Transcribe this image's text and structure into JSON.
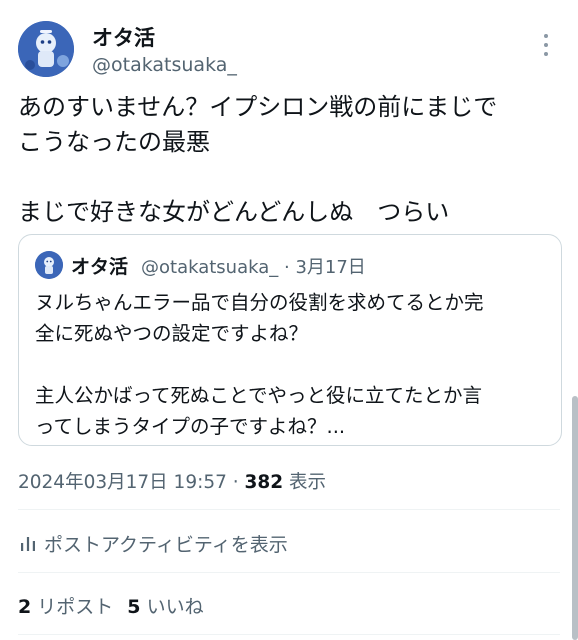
{
  "author": {
    "display_name": "オタ活",
    "handle": "@otakatsuaka_"
  },
  "tweet": {
    "text": "あのすいません？イプシロン戦の前にまじで\nこうなったの最悪\n\nまじで好きな女がどんどんしぬ　つらい"
  },
  "quote": {
    "display_name": "オタ活",
    "handle": "@otakatsuaka_",
    "separator": "·",
    "date": "3月17日",
    "text": "ヌルちゃんエラー品で自分の役割を求めてるとか完\n全に死ぬやつの設定ですよね？\n\n主人公かばって死ぬことでやっと役に立てたとか言\nってしまうタイプの子ですよね？..."
  },
  "meta": {
    "timestamp": "2024年03月17日 19:57",
    "separator": "·",
    "views": "382",
    "views_label": "表示"
  },
  "activity": {
    "label": "ポストアクティビティを表示",
    "icon": "bar-chart-icon"
  },
  "stats": {
    "reposts": "2",
    "reposts_label": "リポスト",
    "likes": "5",
    "likes_label": "いいね"
  },
  "colors": {
    "text_primary": "#0f1419",
    "text_secondary": "#536471",
    "border": "#cfd9de",
    "divider": "#eff3f4"
  }
}
